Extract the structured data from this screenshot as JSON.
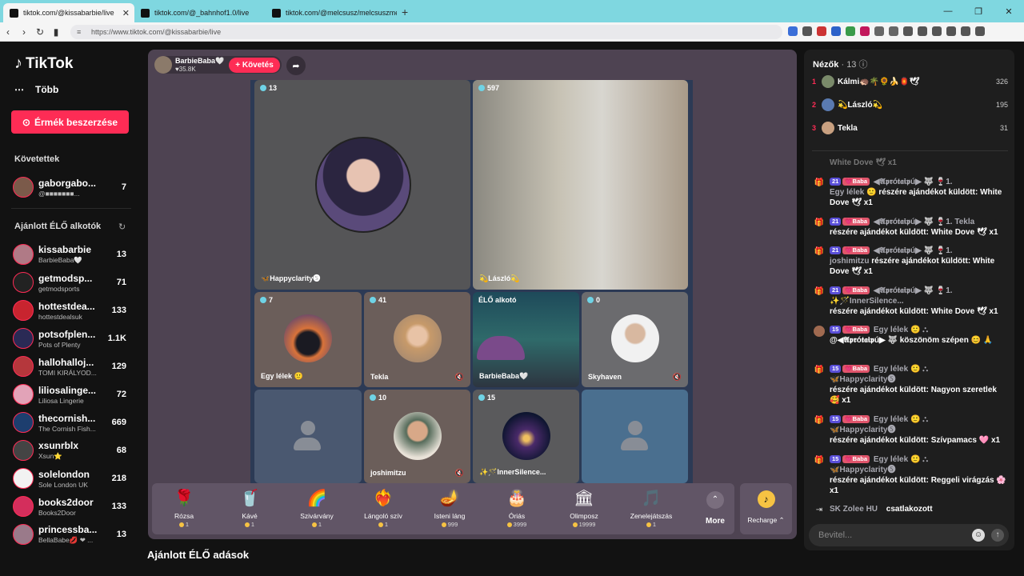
{
  "browser": {
    "tabs": [
      {
        "title": "tiktok.com/@kissabarbie/live"
      },
      {
        "title": "tiktok.com/@_bahnhof1.0/live"
      },
      {
        "title": "tiktok.com/@melcsusz/melcsuszmelcsu..."
      }
    ],
    "url": "https://www.tiktok.com/@kissabarbie/live",
    "new_tab": "+",
    "nav_back": "‹",
    "nav_forward": "›",
    "nav_reload": "↻"
  },
  "sidebar": {
    "logo": "TikTok",
    "more_label": "Több",
    "buy_coins_label": "Érmék beszerzése",
    "following_title": "Követettek",
    "following": [
      {
        "name": "gaborgabo...",
        "sub": "@■■■■■■■...",
        "count": "7"
      }
    ],
    "recommended_title": "Ajánlott ÉLŐ alkotók",
    "recommended": [
      {
        "name": "kissabarbie",
        "sub": "BarbieBaba🤍",
        "count": "13"
      },
      {
        "name": "getmodsp...",
        "sub": "getmodsports",
        "count": "71"
      },
      {
        "name": "hottestdea...",
        "sub": "hottestdealsuk",
        "count": "133"
      },
      {
        "name": "potsofplen...",
        "sub": "Pots of Plenty",
        "count": "1.1K"
      },
      {
        "name": "hallohalloj...",
        "sub": "TOMI KIRÁLYOD...",
        "count": "129"
      },
      {
        "name": "liliosalinge...",
        "sub": "Liliosa Lingerie",
        "count": "72"
      },
      {
        "name": "thecornish...",
        "sub": "The Cornish Fish...",
        "count": "669"
      },
      {
        "name": "xsunrblx",
        "sub": "Xsun⭐",
        "count": "68"
      },
      {
        "name": "solelondon",
        "sub": "Sole London UK",
        "count": "218"
      },
      {
        "name": "books2door",
        "sub": "Books2Door",
        "count": "133"
      },
      {
        "name": "princessba...",
        "sub": "BellaBabe💋 ❤ ...",
        "count": "13"
      }
    ]
  },
  "live": {
    "host_name": "BarbieBaba🤍",
    "host_likes": "♥35.8K",
    "follow_label": "+ Követés",
    "cells": [
      {
        "badge": "13",
        "name": "🦋Happyclarity🅢"
      },
      {
        "badge": "597",
        "name": "💫László💫"
      },
      {
        "badge": "7",
        "name": "Egy lélek 🙂"
      },
      {
        "badge": "41",
        "name": "Tekla"
      },
      {
        "badge": "ÉLŐ alkotó",
        "name": "BarbieBaba🤍"
      },
      {
        "badge": "0",
        "name": "Skyhaven"
      },
      {
        "badge": "",
        "name": ""
      },
      {
        "badge": "10",
        "name": "joshimitzu"
      },
      {
        "badge": "15",
        "name": "✨🪄InnerSilence..."
      },
      {
        "badge": "",
        "name": ""
      }
    ],
    "gifts": [
      {
        "icon": "🌹",
        "name": "Rózsa",
        "price": "1"
      },
      {
        "icon": "🥤",
        "name": "Kávé",
        "price": "1"
      },
      {
        "icon": "🌈",
        "name": "Szivárvány",
        "price": "1"
      },
      {
        "icon": "❤️‍🔥",
        "name": "Lángoló szív",
        "price": "1"
      },
      {
        "icon": "🪔",
        "name": "Isteni láng",
        "price": "999"
      },
      {
        "icon": "🎂",
        "name": "Óriás",
        "price": "3999"
      },
      {
        "icon": "🏛",
        "name": "Olimposz",
        "price": "19999"
      },
      {
        "icon": "🎵",
        "name": "Zenelejátszás",
        "price": "1"
      }
    ],
    "more_label": "More",
    "recharge_label": "Recharge ⌃"
  },
  "recommended_live_title": "Ajánlott ÉLŐ adások",
  "right_panel": {
    "viewers_title": "Nézők",
    "viewers_count": "· 13",
    "top_viewers": [
      {
        "rank": "1",
        "name": "Kálmi🦔🌴🌻🍌🏮🕊",
        "score": "326"
      },
      {
        "rank": "2",
        "name": "💫László💫",
        "score": "195"
      },
      {
        "rank": "3",
        "name": "Tekla",
        "score": "31"
      }
    ],
    "chat": [
      {
        "faded": "White Dove 🕊 x1"
      },
      {
        "lvl": "21",
        "fan": "💗Baba",
        "user": "◀𝕬𝖕𝖗ó𝖙𝖆𝖎𝖕ú▶ 🐺 🍷1.",
        "user2": "Egy lélek 🙂",
        "text": "részére ajándékot küldött: White Dove 🕊 x1"
      },
      {
        "lvl": "21",
        "fan": "💗Baba",
        "user": "◀𝕬𝖕𝖗ó𝖙𝖆𝖎𝖕ú▶ 🐺 🍷1. Tekla",
        "user2": "",
        "text": "részére ajándékot küldött: White Dove 🕊 x1"
      },
      {
        "lvl": "21",
        "fan": "💗Baba",
        "user": "◀𝕬𝖕𝖗ó𝖙𝖆𝖎𝖕ú▶ 🐺 🍷1.",
        "user2": "joshimitzu",
        "text": "részére ajándékot küldött: White Dove 🕊 x1"
      },
      {
        "lvl": "21",
        "fan": "💗Baba",
        "user": "◀𝕬𝖕𝖗ó𝖙𝖆𝖎𝖕ú▶ 🐺 🍷1.",
        "user2": "✨🪄InnerSilence...",
        "text": "részére ajándékot küldött: White Dove 🕊 x1"
      },
      {
        "lvl": "15",
        "fan": "💗Baba",
        "user": "Egy lélek 🙂 ⛬",
        "user2": "",
        "text": "@◀𝕬𝖕𝖗ó𝖙𝖆𝖎𝖕ú▶ 🐺 köszönöm szépen 😊 🙏"
      },
      {
        "lvl": "15",
        "fan": "💗Baba",
        "user": "Egy lélek 🙂 ⛬",
        "user2": "🦋Happyclarity🅢",
        "text": "részére ajándékot küldött: Nagyon szeretlek 🥰 x1"
      },
      {
        "lvl": "15",
        "fan": "💗Baba",
        "user": "Egy lélek 🙂 ⛬",
        "user2": "🦋Happyclarity🅢",
        "text": "részére ajándékot küldött: Szívpamacs 🩷 x1"
      },
      {
        "lvl": "15",
        "fan": "💗Baba",
        "user": "Egy lélek 🙂 ⛬",
        "user2": "🦋Happyclarity🅢",
        "text": "részére ajándékot küldött: Reggeli virágzás 🌸 x1"
      },
      {
        "user": "SK Zolee HU",
        "text": "csatlakozott"
      }
    ],
    "input_placeholder": "Bevitel..."
  }
}
